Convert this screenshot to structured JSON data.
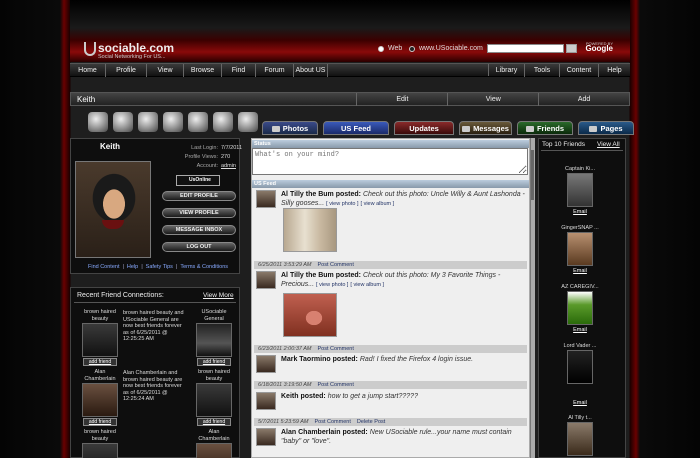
{
  "header": {
    "logo": "sociable.com",
    "tagline": "Social Networking For US...",
    "search_web": "Web",
    "search_site": "www.USociable.com",
    "search_placeholder": "",
    "google_powered": "POWERED BY",
    "google": "Google"
  },
  "nav": {
    "left": [
      "Home",
      "Profile",
      "View",
      "Browse",
      "Find",
      "Forum",
      "About US"
    ],
    "right": [
      "Library",
      "Tools",
      "Content",
      "Help"
    ]
  },
  "profile_bar": {
    "name": "Keith",
    "links": [
      "Edit",
      "View",
      "Add"
    ]
  },
  "tabs": [
    {
      "label": "Photos",
      "color": "#2a3a6a"
    },
    {
      "label": "US Feed",
      "color": "#1a3a8a"
    },
    {
      "label": "Updates",
      "color": "#6a1a1a"
    },
    {
      "label": "Messages",
      "color": "#4a3a20"
    },
    {
      "label": "Friends",
      "color": "#1a4a1a"
    },
    {
      "label": "Pages",
      "color": "#1a3a5a"
    }
  ],
  "profile": {
    "name": "Keith",
    "last_login_label": "Last Login:",
    "last_login": "7/7/2011",
    "views_label": "Profile Views:",
    "views": "270",
    "account_label": "Account:",
    "account": "admin",
    "badge": "UsOnline",
    "buttons": [
      "EDIT PROFILE",
      "VIEW PROFILE",
      "MESSAGE INBOX",
      "LOG OUT"
    ],
    "links": [
      "Find Content",
      "Help",
      "Safety Tips",
      "Terms & Conditions"
    ],
    "sep": "|"
  },
  "recent": {
    "title": "Recent Friend Connections:",
    "view_more": "View More",
    "add_friend": "add friend",
    "rows": [
      {
        "left": "brown haired beauty",
        "text": "brown haired beauty and USociable General are now best friends forever as of 6/25/2011 @ 12:25:25 AM",
        "right": "USociable General"
      },
      {
        "left": "Alan Chamberlain",
        "text": "Alan Chamberlain and brown haired beauty are now best friends forever as of 6/25/2011 @ 12:25:24 AM",
        "right": "brown haired beauty"
      },
      {
        "left": "brown haired beauty",
        "text": "",
        "right": "Alan Chamberlain"
      }
    ]
  },
  "status": {
    "header": "Status",
    "placeholder": "What's on your mind?"
  },
  "feed": {
    "header": "US Feed",
    "post_comment": "Post Comment",
    "delete_post": "Delete Post",
    "items": [
      {
        "author": "Al Tilly the Bum posted:",
        "text": "Check out this photo: Uncle Willy & Aunt Lashonda - Silly gooses...",
        "view_photo": "[ view photo ]",
        "view_album": "[ view album ]",
        "time": "6/25/2011 3:53:29 AM"
      },
      {
        "author": "Al Tilly the Bum posted:",
        "text": "Check out this photo: My 3 Favorite Things - Precious...",
        "view_photo": "[ view photo ]",
        "view_album": "[ view album ]",
        "time": "6/23/2011 2:00:37 AM"
      },
      {
        "author": "Mark Taormino posted:",
        "text": "Rad! I fixed the Firefox 4 login issue.",
        "time": "6/18/2011 3:19:50 AM"
      },
      {
        "author": "Keith posted:",
        "text": "how to get a jump start?????",
        "time": "5/7/2011 5:23:59 AM"
      },
      {
        "author": "Alan Chamberlain posted:",
        "text": "New USociable rule...your name must contain \"baby\" or \"love\".",
        "time": ""
      }
    ]
  },
  "top10": {
    "title": "Top 10 Friends",
    "view_all": "View All",
    "email": "Email",
    "friends": [
      "Captain Ki...",
      "GingerSNAP ...",
      "AZ CAREGIV...",
      "Lord Vader ...",
      "Al Tilly t..."
    ]
  },
  "colors": {
    "accent_red": "#8a0a0a",
    "link": "#223366"
  }
}
